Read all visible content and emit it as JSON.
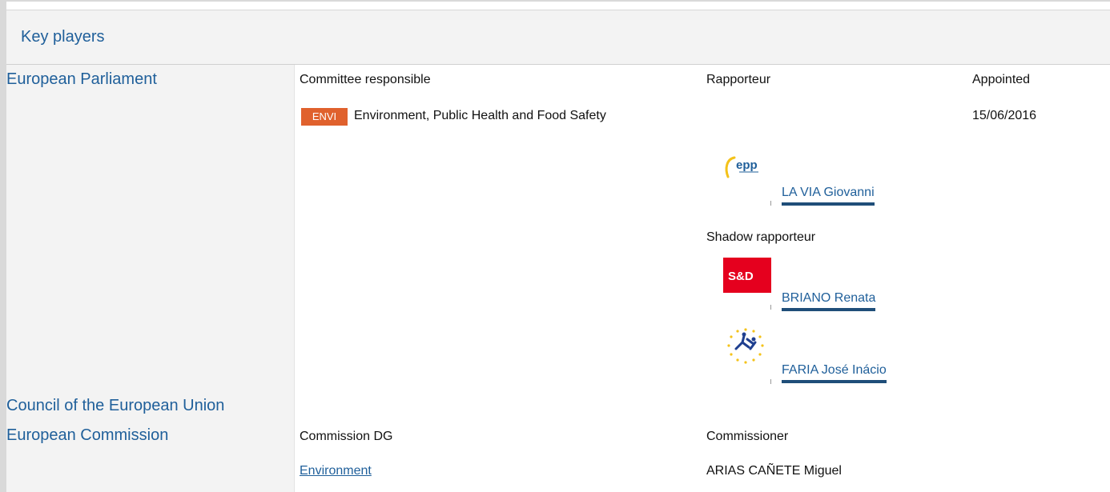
{
  "header": {
    "title": "Key players"
  },
  "institutions": {
    "parliament": "European Parliament",
    "council": "Council of the European Union",
    "commission": "European Commission"
  },
  "parliament": {
    "col_committee": "Committee responsible",
    "col_rapporteur": "Rapporteur",
    "col_appointed": "Appointed",
    "committee_code": "ENVI",
    "committee_name": "Environment, Public Health and Food Safety",
    "appointed_date": "15/06/2016",
    "rapporteur": {
      "name": "LA VIA Giovanni",
      "group_logo": "epp-logo",
      "logo_text": "epp"
    },
    "shadow_label": "Shadow rapporteur",
    "shadow_rapporteurs": [
      {
        "name": "BRIANO Renata",
        "group_logo": "sd-logo",
        "logo_text": "S&D"
      },
      {
        "name": "FARIA José Inácio",
        "group_logo": "efdd-logo"
      }
    ]
  },
  "commission": {
    "col_dg": "Commission DG",
    "col_commissioner": "Commissioner",
    "dg": "Environment",
    "commissioner": "ARIAS CAÑETE Miguel"
  },
  "colors": {
    "link": "#1f5f9a",
    "badge": "#e0612d",
    "underline_bar": "#1f4e79",
    "sd_red": "#e5001e"
  }
}
